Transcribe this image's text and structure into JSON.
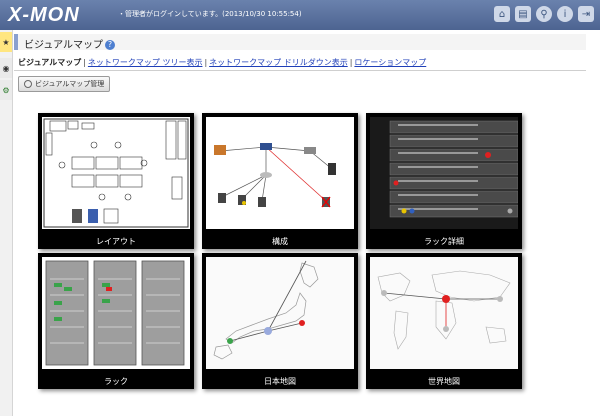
{
  "header": {
    "logo": "X-MON",
    "status": "・管理者がログインしています。(2013/10/30 10:55:54)",
    "icons": [
      "home-icon",
      "document-icon",
      "search-icon",
      "info-icon",
      "logout-icon"
    ]
  },
  "sidebar": {
    "tabs": [
      "star-icon",
      "eye-icon",
      "gear-icon"
    ]
  },
  "page": {
    "title": "ビジュアルマップ"
  },
  "nav": {
    "current": "ビジュアルマップ",
    "links": [
      "ネットワークマップ ツリー表示",
      "ネットワークマップ ドリルダウン表示",
      "ロケーションマップ"
    ]
  },
  "toolbar": {
    "manage_label": "ビジュアルマップ管理"
  },
  "cards": [
    {
      "label": "レイアウト"
    },
    {
      "label": "構成"
    },
    {
      "label": "ラック詳細"
    },
    {
      "label": "ラック"
    },
    {
      "label": "日本地図"
    },
    {
      "label": "世界地図"
    }
  ]
}
